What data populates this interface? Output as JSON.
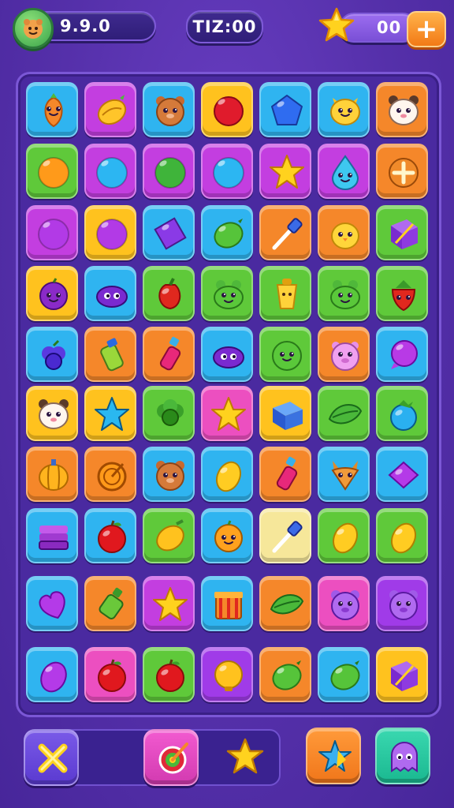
{
  "hud": {
    "score": "9.9.0",
    "time": "TIZ:00",
    "stars": "00",
    "plus_label": "+"
  },
  "colors": {
    "blue": "#2fb4f0",
    "purple": "#c33ee0",
    "yellow": "#ffc21e",
    "green": "#5fc93a",
    "orange": "#f5872a",
    "violet": "#a03be8",
    "pink": "#ec4fc0",
    "pale": "#f6e79a"
  },
  "board": {
    "rows": [
      [
        [
          "blue",
          "carrot"
        ],
        [
          "purple",
          "banana"
        ],
        [
          "blue",
          "bear"
        ],
        [
          "yellow",
          "cherry"
        ],
        [
          "blue",
          "pentagon"
        ],
        [
          "blue",
          "cat"
        ],
        [
          "orange",
          "panda"
        ]
      ],
      [
        [
          "green",
          "orange-ball"
        ],
        [
          "purple",
          "blue-ball"
        ],
        [
          "purple",
          "green-ball"
        ],
        [
          "purple",
          "blue-ball"
        ],
        [
          "purple",
          "star"
        ],
        [
          "purple",
          "drop"
        ],
        [
          "orange",
          "plus-gem"
        ]
      ],
      [
        [
          "purple",
          "purple-ball"
        ],
        [
          "yellow",
          "purple-ball"
        ],
        [
          "blue",
          "diamond"
        ],
        [
          "blue",
          "lime"
        ],
        [
          "orange",
          "wand"
        ],
        [
          "orange",
          "chick"
        ],
        [
          "green",
          "box-purple"
        ]
      ],
      [
        [
          "yellow",
          "plum"
        ],
        [
          "blue",
          "eggplant"
        ],
        [
          "green",
          "pepper"
        ],
        [
          "green",
          "frog"
        ],
        [
          "green",
          "cup"
        ],
        [
          "green",
          "frog"
        ],
        [
          "green",
          "strawberry"
        ]
      ],
      [
        [
          "blue",
          "grape"
        ],
        [
          "orange",
          "bottle"
        ],
        [
          "orange",
          "potion"
        ],
        [
          "blue",
          "eggplant"
        ],
        [
          "green",
          "smile-ball"
        ],
        [
          "orange",
          "pig"
        ],
        [
          "blue",
          "bubble"
        ]
      ],
      [
        [
          "yellow",
          "panda"
        ],
        [
          "yellow",
          "blue-star"
        ],
        [
          "green",
          "broccoli"
        ],
        [
          "pink",
          "star"
        ],
        [
          "yellow",
          "blue-box"
        ],
        [
          "green",
          "leaf"
        ],
        [
          "green",
          "blueberry"
        ]
      ],
      [
        [
          "orange",
          "squash"
        ],
        [
          "orange",
          "orange-ring"
        ],
        [
          "blue",
          "bear"
        ],
        [
          "blue",
          "lemon"
        ],
        [
          "orange",
          "potion"
        ],
        [
          "blue",
          "fox"
        ],
        [
          "blue",
          "purple-box"
        ]
      ],
      [
        [
          "blue",
          "stack"
        ],
        [
          "blue",
          "apple"
        ],
        [
          "green",
          "mango"
        ],
        [
          "blue",
          "orange-face"
        ],
        [
          "pale",
          "wand"
        ],
        [
          "green",
          "lemon"
        ],
        [
          "green",
          "lemon"
        ]
      ],
      [
        [
          "blue",
          "heart"
        ],
        [
          "orange",
          "green-bottle"
        ],
        [
          "purple",
          "star"
        ],
        [
          "blue",
          "gift"
        ],
        [
          "orange",
          "leaf"
        ],
        [
          "pink",
          "pig-purple"
        ],
        [
          "violet",
          "pig-purple"
        ]
      ],
      [
        [
          "blue",
          "purple-egg"
        ],
        [
          "pink",
          "apple"
        ],
        [
          "green",
          "apple"
        ],
        [
          "violet",
          "yellow-bulb"
        ],
        [
          "orange",
          "lime"
        ],
        [
          "blue",
          "lime"
        ],
        [
          "yellow",
          "box-purple"
        ]
      ]
    ]
  },
  "bottom": {
    "buttons": [
      {
        "name": "shuffle-cancel-button",
        "icon": "x-mark-icon",
        "bg": "violet-blue"
      },
      {
        "name": "target-booster-button",
        "icon": "target-arrow-icon",
        "bg": "pink"
      },
      {
        "name": "star-booster-button",
        "icon": "star-icon",
        "bg": "none"
      },
      {
        "name": "hammer-booster-button",
        "icon": "sparkle-star-icon",
        "bg": "orange"
      },
      {
        "name": "ghost-booster-button",
        "icon": "ghost-icon",
        "bg": "teal"
      }
    ]
  }
}
